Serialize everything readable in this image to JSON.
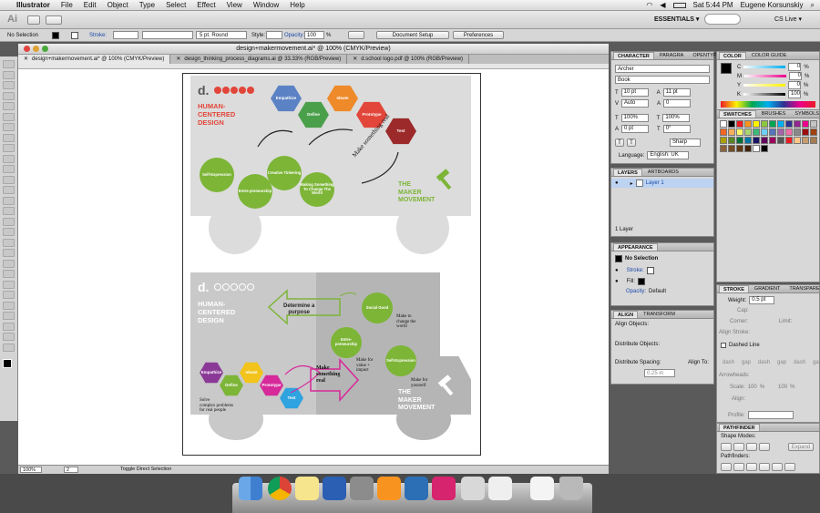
{
  "menubar": {
    "apple": "",
    "app": "Illustrator",
    "items": [
      "File",
      "Edit",
      "Object",
      "Type",
      "Select",
      "Effect",
      "View",
      "Window",
      "Help"
    ],
    "clock": "Sat 5:44 PM",
    "user": "Eugene Korsunskiy"
  },
  "appbar": {
    "logo": "Ai",
    "workspace": "ESSENTIALS ▾",
    "cslive": "CS Live ▾"
  },
  "controlbar": {
    "selection": "No Selection",
    "stroke_label": "Stroke:",
    "stroke_profile": "5 pt. Round",
    "style_label": "Style:",
    "opacity_label": "Opacity:",
    "opacity_value": "100",
    "opacity_unit": "%",
    "document_setup": "Document Setup",
    "preferences": "Preferences"
  },
  "document": {
    "title": "design+makermovement.ai* @ 100% (CMYK/Preview)",
    "tabs": [
      "design+makermovement.ai* @ 100% (CMYK/Preview)",
      "design_thinking_process_diagrams.ai @ 33.33% (RGB/Preview)",
      "d.school logo.pdf @ 100% (RGB/Preview)"
    ]
  },
  "statusbar": {
    "zoom": "100%",
    "page": "2",
    "status": "Toggle Direct Selection"
  },
  "artwork": {
    "logo": "d.",
    "top": {
      "title_lines": [
        "HUMAN-",
        "CENTERED",
        "DESIGN"
      ],
      "hexes": [
        "Empathize",
        "Define",
        "Ideate",
        "Prototype",
        "Test"
      ],
      "circles": [
        "Self-Expression",
        "Entre-preneurship",
        "Creative Tinkering",
        "Making Something To Change The World"
      ],
      "curve_text": "Make something real",
      "maker": [
        "THE",
        "MAKER",
        "MOVEMENT"
      ]
    },
    "bottom": {
      "title_lines": [
        "HUMAN-",
        "CENTERED",
        "DESIGN"
      ],
      "purpose": [
        "Determine a",
        "purpose"
      ],
      "circles": [
        "Social Good",
        "Entre-preneurship",
        "Self-Expression"
      ],
      "notes": [
        [
          "Make to",
          "change the",
          "world"
        ],
        [
          "Make for",
          "value +",
          "impact"
        ],
        [
          "Make for",
          "yourself"
        ]
      ],
      "hexes": [
        "Empathize",
        "Define",
        "Ideate",
        "Prototype",
        "Test"
      ],
      "solve": [
        "Solve",
        "complex problems",
        "for real people"
      ],
      "arrow_text": [
        "Make",
        "something",
        "real"
      ],
      "maker": [
        "THE",
        "MAKER",
        "MOVEMENT"
      ]
    }
  },
  "character": {
    "tabs": [
      "CHARACTER",
      "PARAGRA",
      "OPENTYPE"
    ],
    "font": "Archer",
    "style": "Book",
    "size": "10 pt",
    "leading": "11 pt",
    "kern": "Auto",
    "tracking": "0",
    "hscale": "100%",
    "vscale": "100%",
    "baseline": "0 pt",
    "rotation": "0°",
    "aa": "Sharp",
    "language_label": "Language:",
    "language": "English: UK"
  },
  "color": {
    "tabs": [
      "COLOR",
      "COLOR GUIDE"
    ],
    "labels": [
      "C",
      "M",
      "Y",
      "K"
    ],
    "values": [
      "0",
      "0",
      "0",
      "100"
    ],
    "unit": "%"
  },
  "swatches": {
    "tabs": [
      "SWATCHES",
      "BRUSHES",
      "SYMBOLS"
    ],
    "colors": [
      "#ffffff",
      "#000000",
      "#ed1c24",
      "#f7941d",
      "#fff200",
      "#8dc63f",
      "#00a651",
      "#00aeef",
      "#2e3192",
      "#92278f",
      "#ec008c",
      "#c4c4c4",
      "#f26522",
      "#fbaf5d",
      "#fff568",
      "#acd373",
      "#3cb878",
      "#6dcff6",
      "#5674b9",
      "#a864a8",
      "#f06eaa",
      "#898989",
      "#9e0b0f",
      "#a0410d",
      "#aba000",
      "#598527",
      "#007236",
      "#0076a3",
      "#1b1464",
      "#630460",
      "#9e005d",
      "#555555",
      "#ed1c24",
      "#fdc689",
      "#c69c6d",
      "#a67c52",
      "#8c6239",
      "#754c24",
      "#603913",
      "#42210b",
      "#ffffff",
      "#000000"
    ]
  },
  "layers": {
    "tabs": [
      "LAYERS",
      "ARTBOARDS"
    ],
    "layer": "Layer 1",
    "count": "1 Layer"
  },
  "appearance": {
    "tabs": [
      "APPEARANCE"
    ],
    "selection": "No Selection",
    "stroke": "Stroke:",
    "fill": "Fill:",
    "opacity": "Opacity:",
    "opacity_value": "Default"
  },
  "align": {
    "tabs": [
      "ALIGN",
      "TRANSFORM"
    ],
    "align_objects": "Align Objects:",
    "distribute_objects": "Distribute Objects:",
    "distribute_spacing": "Distribute Spacing:",
    "align_to": "Align To:",
    "spacing_value": "0.25 in"
  },
  "stroke": {
    "tabs": [
      "STROKE",
      "GRADIENT",
      "TRANSPARE"
    ],
    "weight_label": "Weight:",
    "weight": "0.5 pt",
    "cap": "Cap:",
    "corner": "Corner:",
    "limit": "Limit:",
    "align_stroke": "Align Stroke:",
    "dashed": "Dashed Line",
    "dash": [
      "dash",
      "gap",
      "dash",
      "gap",
      "dash",
      "gap"
    ],
    "arrowheads": "Arrowheads:",
    "scale": "Scale:",
    "scale_a": "100",
    "scale_b": "100",
    "pct": "%",
    "align": "Align:",
    "profile": "Profile:"
  },
  "pathfinder": {
    "tabs": [
      "PATHFINDER"
    ],
    "shape_modes": "Shape Modes:",
    "pathfinders": "Pathfinders:",
    "expand": "Expand"
  }
}
